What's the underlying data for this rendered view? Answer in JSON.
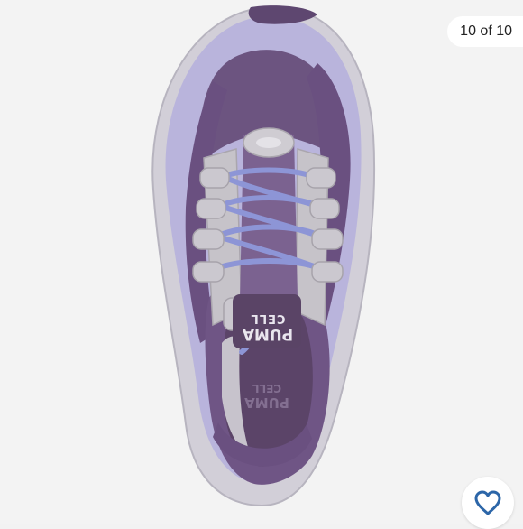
{
  "gallery": {
    "counter": "10 of 10",
    "image_alt": "Purple PUMA Cell sneaker, top view",
    "brand_print": "PUMA",
    "model_print": "CELL"
  },
  "actions": {
    "like_icon": "heart-outline-icon"
  },
  "colors": {
    "shoe_dark": "#5e4770",
    "shoe_mid": "#7a5f8a",
    "shoe_lavender": "#b8b3d9",
    "shoe_grey": "#c9c6cc",
    "laces": "#8d95d6",
    "heart": "#2c66a8"
  }
}
